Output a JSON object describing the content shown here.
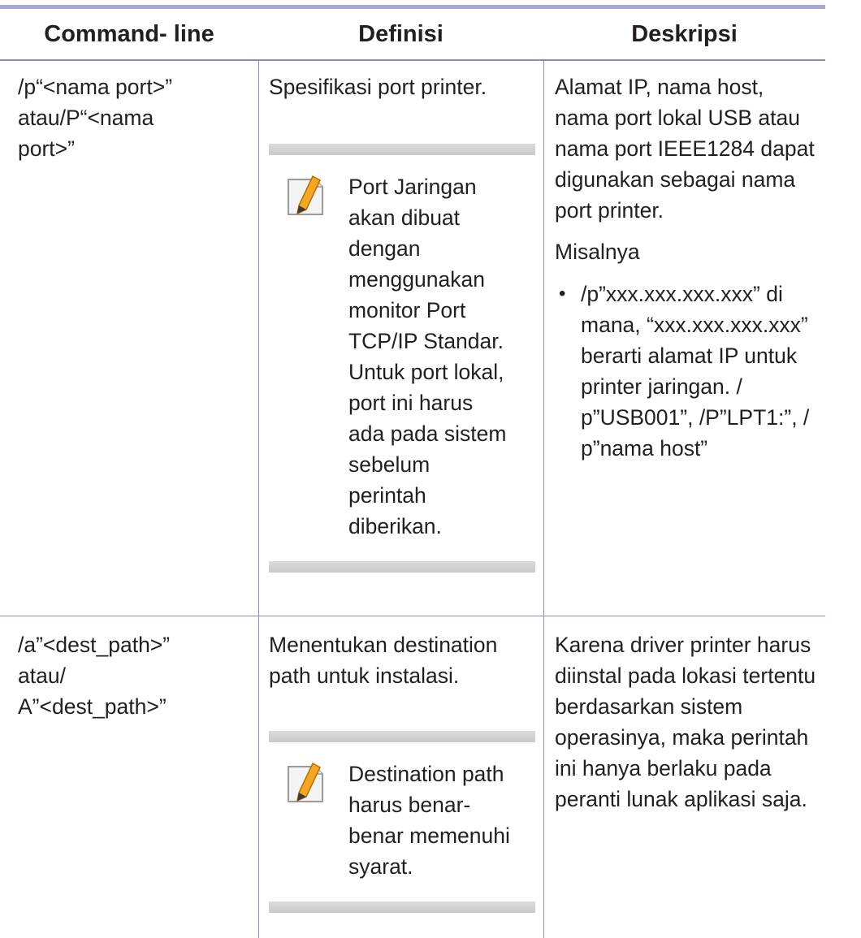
{
  "table": {
    "headers": {
      "command": "Command- line",
      "definition": "Definisi",
      "description": "Deskripsi"
    },
    "rows": [
      {
        "command": [
          "/p“<nama port>”",
          "atau/P“<nama",
          "port>”"
        ],
        "definition": "Spesifikasi port printer.",
        "note_icon": "pencil-note-icon",
        "note": [
          "Port Jaringan",
          "akan dibuat",
          "dengan",
          "menggunakan",
          "monitor Port",
          "TCP/IP Standar.",
          "Untuk port lokal,",
          "port ini harus",
          "ada pada sistem",
          "sebelum",
          "perintah",
          "diberikan."
        ],
        "description": [
          "Alamat IP, nama host,",
          "nama port lokal USB atau",
          "nama port IEEE1284 dapat",
          "digunakan sebagai nama",
          "port printer."
        ],
        "example_label": "Misalnya",
        "example_bullet": [
          "/p”xxx.xxx.xxx.xxx” di",
          "mana, “xxx.xxx.xxx.xxx”",
          "berarti alamat IP untuk",
          "printer jaringan. /",
          "p”USB001”, /P”LPT1:”, /",
          "p”nama host”"
        ]
      },
      {
        "command": [
          "/a”<dest_path>”",
          "atau/",
          "A”<dest_path>”"
        ],
        "definition": [
          "Menentukan destination",
          "path untuk instalasi."
        ],
        "note_icon": "pencil-note-icon",
        "note": [
          "Destination path",
          "harus benar-",
          "benar memenuhi",
          "syarat."
        ],
        "description": [
          "Karena driver printer harus",
          "diinstal pada lokasi tertentu",
          "berdasarkan sistem",
          "operasinya, maka perintah",
          "ini hanya berlaku pada",
          "peranti lunak aplikasi saja."
        ]
      }
    ]
  }
}
